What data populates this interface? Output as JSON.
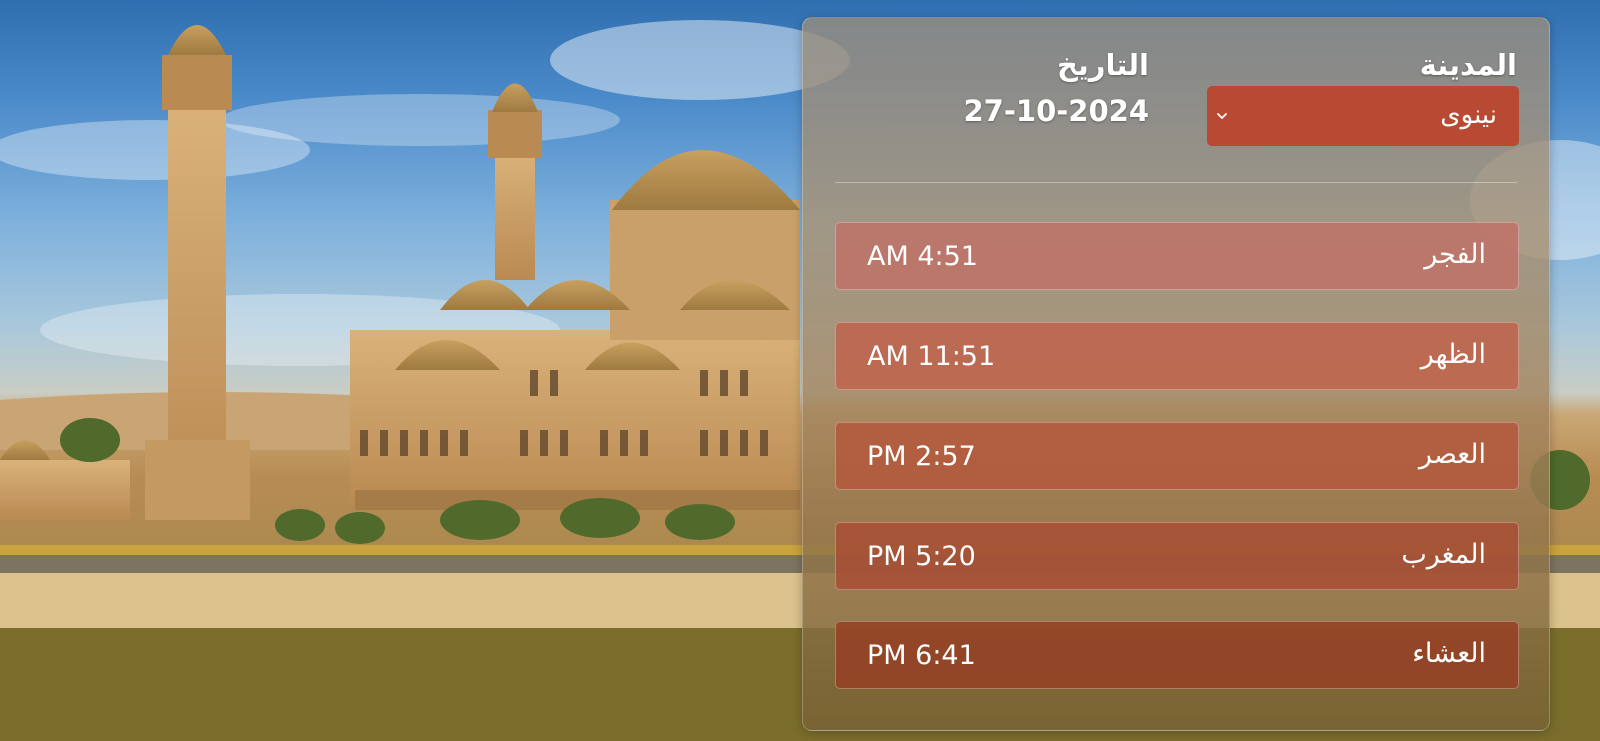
{
  "header": {
    "city_label": "المدينة",
    "date_label": "التاريخ"
  },
  "city_select": {
    "selected": "نينوى",
    "icon": "chevron-down-icon"
  },
  "date": {
    "value": "27-10-2024"
  },
  "prayers": [
    {
      "name": "الفجر",
      "time": "AM 4:51"
    },
    {
      "name": "الظهر",
      "time": "AM 11:51"
    },
    {
      "name": "العصر",
      "time": "PM 2:57"
    },
    {
      "name": "المغرب",
      "time": "PM 5:20"
    },
    {
      "name": "العشاء",
      "time": "PM 6:41"
    }
  ],
  "colors": {
    "select_bg": "#b84a33",
    "text": "#ffffff",
    "sky": "#4d8ccb",
    "stone": "#c9a774"
  }
}
